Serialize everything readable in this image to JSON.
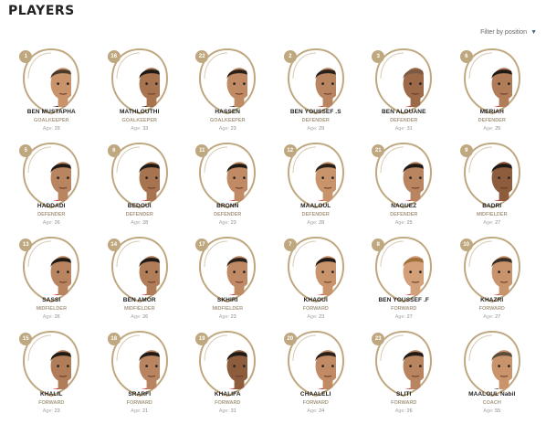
{
  "header": {
    "title": "PLAYERS"
  },
  "filter": {
    "label": "Filter by position"
  },
  "age_label": "Age:",
  "colors": {
    "gold": "#bfa880",
    "shirt_red": "#d8202a",
    "coach_suit": "#222833"
  },
  "players": [
    {
      "number": "1",
      "name": "BEN MUSTAPHA",
      "position": "GOALKEEPER",
      "age": "29",
      "skin": "#c9946c",
      "hair": "#4a3a2a",
      "shirt": "#1c1c1c"
    },
    {
      "number": "16",
      "name": "MATHLOUTHI",
      "position": "GOALKEEPER",
      "age": "33",
      "skin": "#a87450",
      "hair": "#1f1a16",
      "shirt": "#1c1c1c"
    },
    {
      "number": "22",
      "name": "HASSEN",
      "position": "GOALKEEPER",
      "age": "23",
      "skin": "#c08a64",
      "hair": "#2a211a",
      "shirt": "#1c1c1c"
    },
    {
      "number": "2",
      "name": "BEN YOUSSEF .S",
      "position": "DEFENDER",
      "age": "29",
      "skin": "#b98560",
      "hair": "#2a211a",
      "shirt": "#d8202a"
    },
    {
      "number": "3",
      "name": "BEN ALOUANE",
      "position": "DEFENDER",
      "age": "31",
      "skin": "#9c6a48",
      "hair": "#7a5a44",
      "shirt": "#d8202a"
    },
    {
      "number": "6",
      "name": "MERIAH",
      "position": "DEFENDER",
      "age": "25",
      "skin": "#b17c58",
      "hair": "#1f1a16",
      "shirt": "#d8202a"
    },
    {
      "number": "5",
      "name": "HADDADI",
      "position": "DEFENDER",
      "age": "26",
      "skin": "#b98560",
      "hair": "#1f1a16",
      "shirt": "#d8202a"
    },
    {
      "number": "6",
      "name": "BEDOUI",
      "position": "DEFENDER",
      "age": "28",
      "skin": "#a87450",
      "hair": "#1f1a16",
      "shirt": "#d8202a"
    },
    {
      "number": "11",
      "name": "BRONN",
      "position": "DEFENDER",
      "age": "23",
      "skin": "#c08a64",
      "hair": "#1f1a16",
      "shirt": "#d8202a"
    },
    {
      "number": "12",
      "name": "MAALOUL",
      "position": "DEFENDER",
      "age": "28",
      "skin": "#c9946c",
      "hair": "#2a211a",
      "shirt": "#d8202a"
    },
    {
      "number": "21",
      "name": "NAGUEZ",
      "position": "DEFENDER",
      "age": "25",
      "skin": "#b98560",
      "hair": "#1f1a16",
      "shirt": "#d8202a"
    },
    {
      "number": "9",
      "name": "BADRI",
      "position": "MIDFIELDER",
      "age": "27",
      "skin": "#8c5c3c",
      "hair": "#1f1a16",
      "shirt": "#d8202a"
    },
    {
      "number": "13",
      "name": "SASSI",
      "position": "MIDFIELDER",
      "age": "26",
      "skin": "#b98560",
      "hair": "#1f1a16",
      "shirt": "#d8202a"
    },
    {
      "number": "14",
      "name": "BEN AMOR",
      "position": "MIDFIELDER",
      "age": "26",
      "skin": "#b17c58",
      "hair": "#1f1a16",
      "shirt": "#d8202a"
    },
    {
      "number": "17",
      "name": "SKHIRI",
      "position": "MIDFIELDER",
      "age": "23",
      "skin": "#c08a64",
      "hair": "#2a211a",
      "shirt": "#d8202a"
    },
    {
      "number": "7",
      "name": "KHAOUI",
      "position": "FORWARD",
      "age": "23",
      "skin": "#c9946c",
      "hair": "#1f1a16",
      "shirt": "#d8202a"
    },
    {
      "number": "8",
      "name": "BEN YOUSSEF .F",
      "position": "FORWARD",
      "age": "27",
      "skin": "#d4a07a",
      "hair": "#a0703c",
      "shirt": "#d8202a"
    },
    {
      "number": "10",
      "name": "KHAZRI",
      "position": "FORWARD",
      "age": "27",
      "skin": "#c9946c",
      "hair": "#3a2e24",
      "shirt": "#d8202a"
    },
    {
      "number": "15",
      "name": "KHALIL",
      "position": "FORWARD",
      "age": "23",
      "skin": "#b17c58",
      "hair": "#1f1a16",
      "shirt": "#d8202a"
    },
    {
      "number": "18",
      "name": "SRARFI",
      "position": "FORWARD",
      "age": "21",
      "skin": "#b98560",
      "hair": "#1f1a16",
      "shirt": "#d8202a"
    },
    {
      "number": "19",
      "name": "KHALIFA",
      "position": "FORWARD",
      "age": "31",
      "skin": "#8c5c3c",
      "hair": "#1f1a16",
      "shirt": "#d8202a"
    },
    {
      "number": "20",
      "name": "CHAALELI",
      "position": "FORWARD",
      "age": "24",
      "skin": "#c08a64",
      "hair": "#2a211a",
      "shirt": "#d8202a"
    },
    {
      "number": "23",
      "name": "SLITI",
      "position": "FORWARD",
      "age": "26",
      "skin": "#b98560",
      "hair": "#1f1a16",
      "shirt": "#d8202a"
    },
    {
      "number": "",
      "name": "MAALOUL Nabil",
      "position": "COACH",
      "age": "55",
      "skin": "#c9946c",
      "hair": "#5a4a3a",
      "shirt": "#222833"
    }
  ]
}
